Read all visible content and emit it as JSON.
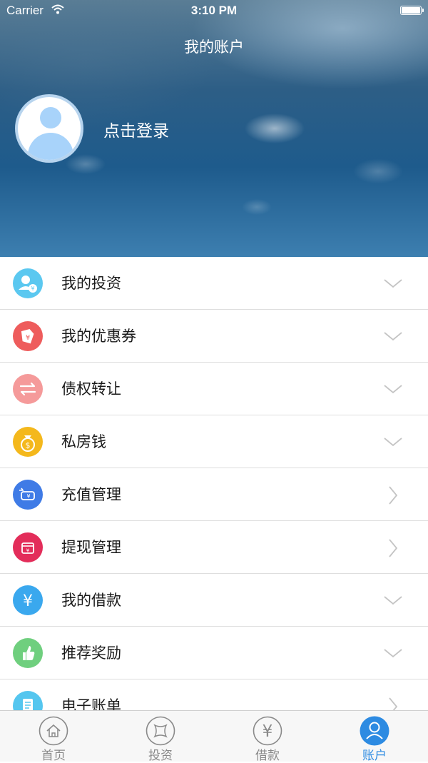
{
  "status_bar": {
    "carrier": "Carrier",
    "time": "3:10 PM"
  },
  "header": {
    "title": "我的账户",
    "login_text": "点击登录"
  },
  "menu": [
    {
      "label": "我的投资",
      "icon": "user-yuan-icon",
      "color": "#5bc8f0",
      "chevron": "down"
    },
    {
      "label": "我的优惠券",
      "icon": "coupon-tag-icon",
      "color": "#ee5c5c",
      "chevron": "down"
    },
    {
      "label": "债权转让",
      "icon": "transfer-arrows-icon",
      "color": "#f59a9a",
      "chevron": "down"
    },
    {
      "label": "私房钱",
      "icon": "money-bag-icon",
      "color": "#f4b81c",
      "chevron": "down"
    },
    {
      "label": "充值管理",
      "icon": "recharge-icon",
      "color": "#3f7be6",
      "chevron": "right"
    },
    {
      "label": "提现管理",
      "icon": "withdraw-icon",
      "color": "#e32d5a",
      "chevron": "right"
    },
    {
      "label": "我的借款",
      "icon": "yuan-icon",
      "color": "#3aa8ee",
      "chevron": "down"
    },
    {
      "label": "推荐奖励",
      "icon": "thumbs-up-icon",
      "color": "#6fcf7e",
      "chevron": "down"
    },
    {
      "label": "电子账单",
      "icon": "bill-icon",
      "color": "#55c6ef",
      "chevron": "right"
    }
  ],
  "tabs": [
    {
      "label": "首页",
      "icon": "home-icon",
      "active": false
    },
    {
      "label": "投资",
      "icon": "invest-icon",
      "active": false
    },
    {
      "label": "借款",
      "icon": "yuan-circle-icon",
      "active": false
    },
    {
      "label": "账户",
      "icon": "account-icon",
      "active": true
    }
  ],
  "colors": {
    "accent": "#2d8be2",
    "inactive": "#8a8a8a",
    "divider": "#dedede"
  }
}
